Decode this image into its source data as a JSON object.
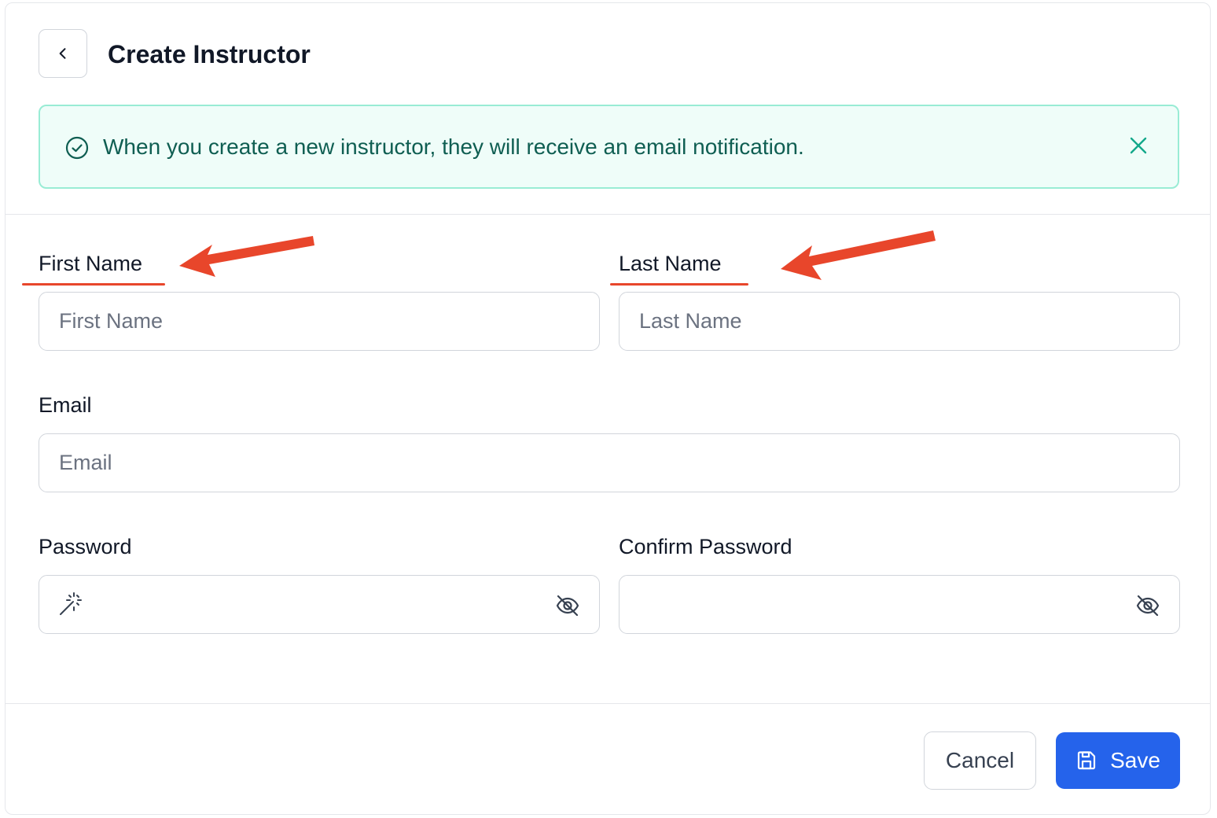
{
  "header": {
    "title": "Create Instructor",
    "back_icon": "chevron-left-icon"
  },
  "alert": {
    "message": "When you create a new instructor, they will receive an email notification.",
    "icon": "check-circle-icon",
    "close_icon": "close-icon",
    "colors": {
      "background": "#effdf9",
      "border": "#99ecd5",
      "text": "#0f5e52"
    }
  },
  "form": {
    "first_name": {
      "label": "First Name",
      "placeholder": "First Name",
      "value": ""
    },
    "last_name": {
      "label": "Last Name",
      "placeholder": "Last Name",
      "value": ""
    },
    "email": {
      "label": "Email",
      "placeholder": "Email",
      "value": ""
    },
    "password": {
      "label": "Password",
      "value": "",
      "left_icon": "magic-wand-icon",
      "right_icon": "eye-off-icon"
    },
    "confirm_password": {
      "label": "Confirm Password",
      "value": "",
      "right_icon": "eye-off-icon"
    }
  },
  "footer": {
    "cancel_label": "Cancel",
    "save_label": "Save",
    "save_icon": "save-icon"
  },
  "annotations": {
    "color": "#e8462b",
    "items": [
      "first-name-label",
      "last-name-label"
    ]
  },
  "colors": {
    "primary": "#2563eb",
    "annotation": "#e8462b"
  }
}
